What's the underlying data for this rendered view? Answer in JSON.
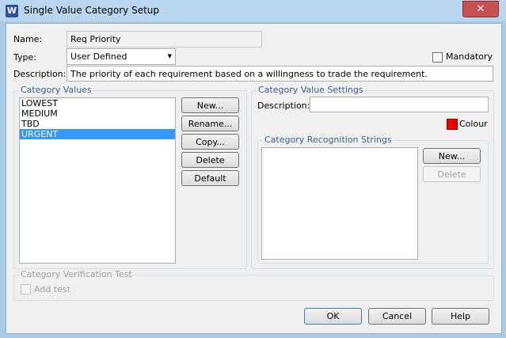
{
  "window": {
    "title": "Single Value Category Setup",
    "app_icon_letter": "W",
    "close_glyph": "✕"
  },
  "form": {
    "name_label": "Name:",
    "name_value": "Req Priority",
    "type_label": "Type:",
    "type_value": "User Defined",
    "mandatory_label": "Mandatory",
    "description_label": "Description:",
    "description_value": "The priority of each requirement based on a willingness to trade the requirement."
  },
  "category_values": {
    "title": "Category Values",
    "items": [
      "LOWEST",
      "MEDIUM",
      "TBD",
      "URGENT"
    ],
    "selected_index": 3,
    "buttons": {
      "new": "New...",
      "rename": "Rename...",
      "copy": "Copy...",
      "delete": "Delete",
      "default": "Default"
    }
  },
  "value_settings": {
    "title": "Category Value Settings",
    "description_label": "Description:",
    "description_value": "",
    "colour_label": "Colour",
    "colour": "#ee0000"
  },
  "recognition": {
    "title": "Category Recognition Strings",
    "new_label": "New...",
    "delete_label": "Delete"
  },
  "verification": {
    "title": "Category Verification Test",
    "add_test_label": "Add test"
  },
  "footer": {
    "ok": "OK",
    "cancel": "Cancel",
    "help": "Help"
  }
}
